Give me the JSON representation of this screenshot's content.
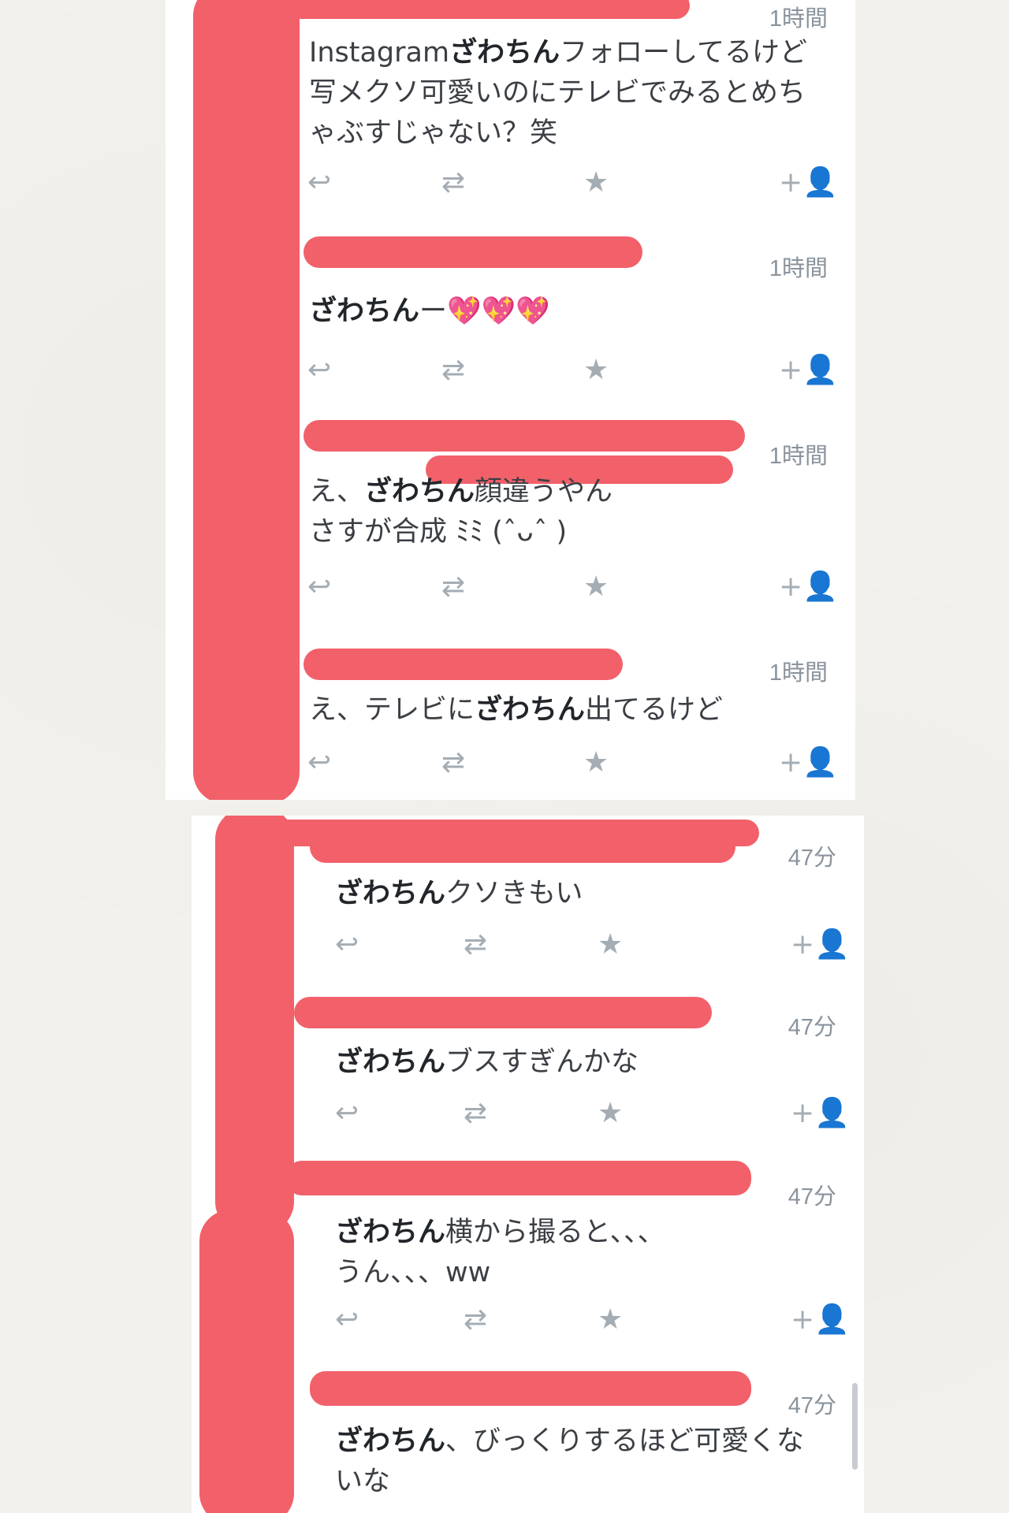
{
  "colors": {
    "redaction": "#f2606a",
    "meta": "#8a939c",
    "icon": "#a5adb4"
  },
  "icons": {
    "reply": "↩",
    "retweet": "⇄",
    "favorite": "★",
    "follow": "+👤"
  },
  "top_panel": {
    "tweets": [
      {
        "time": "1時間",
        "keyword": "ざわちん",
        "prefix": "Instagram",
        "body": "フォローしてるけど写メクソ可愛いのにテレビでみるとめちゃぶすじゃない？笑"
      },
      {
        "time": "1時間",
        "keyword": "ざわちん",
        "prefix": "",
        "body": "ー💖💖💖"
      },
      {
        "time": "1時間",
        "keyword": "ざわちん",
        "prefix": "え、",
        "body": "顔違うやん\nさすが合成 ﾐﾐ (ˆᴗˆ )"
      },
      {
        "time": "1時間",
        "keyword": "ざわちん",
        "prefix": "え、テレビに",
        "body": "出てるけど"
      }
    ]
  },
  "bottom_panel": {
    "tweets": [
      {
        "time": "47分",
        "keyword": "ざわちん",
        "prefix": "",
        "body": "クソきもい"
      },
      {
        "time": "47分",
        "keyword": "ざわちん",
        "prefix": "",
        "body": "ブスすぎんかな"
      },
      {
        "time": "47分",
        "keyword": "ざわちん",
        "prefix": "",
        "body": "横から撮ると、、、\nうん、、、ww"
      },
      {
        "time": "47分",
        "keyword": "ざわちん",
        "prefix": "",
        "body": "、びっくりするほど可愛くないな"
      }
    ]
  }
}
